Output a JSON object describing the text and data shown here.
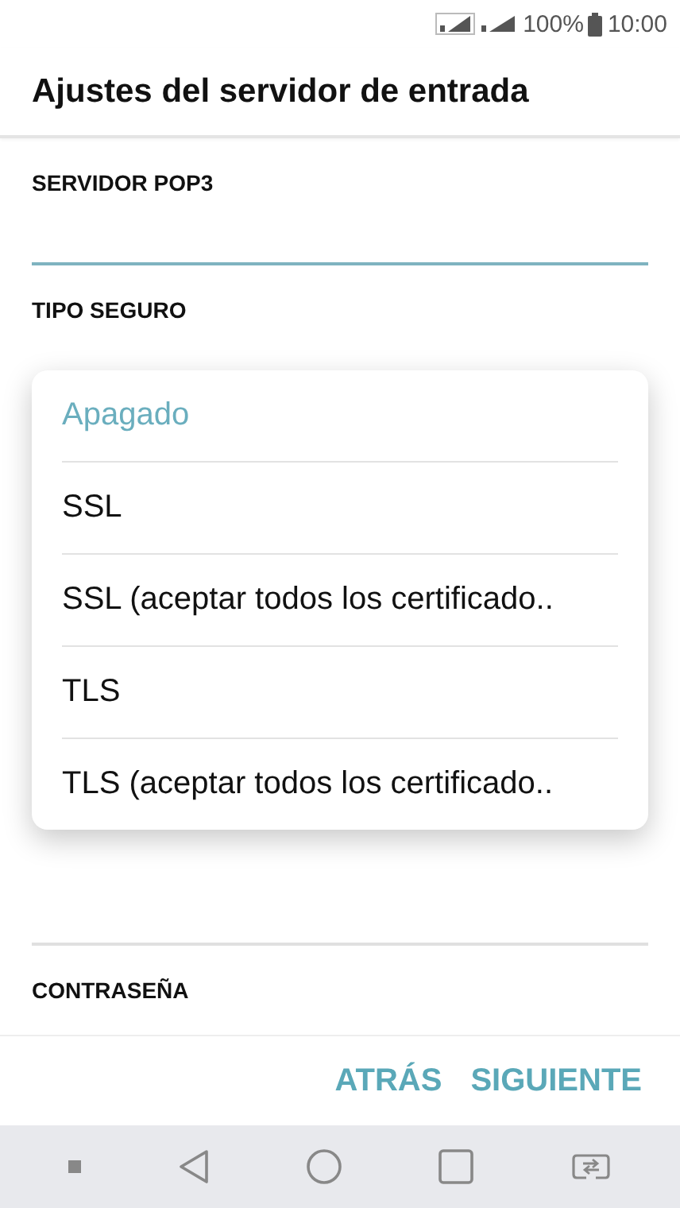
{
  "status_bar": {
    "battery": "100%",
    "time": "10:00"
  },
  "app_bar": {
    "title": "Ajustes del servidor de entrada"
  },
  "fields": [
    {
      "label": "SERVIDOR POP3",
      "focused": true
    },
    {
      "label": "TIPO SEGURO",
      "focused": false
    }
  ],
  "dropdown": {
    "options": [
      {
        "label": "Apagado",
        "selected": true
      },
      {
        "label": "SSL",
        "selected": false
      },
      {
        "label": "SSL (aceptar todos los certificado..",
        "selected": false
      },
      {
        "label": "TLS",
        "selected": false
      },
      {
        "label": "TLS (aceptar todos los certificado..",
        "selected": false
      }
    ]
  },
  "password_label": "CONTRASEÑA",
  "buttons": [
    {
      "label": "ATRÁS"
    },
    {
      "label": "SIGUIENTE"
    }
  ]
}
